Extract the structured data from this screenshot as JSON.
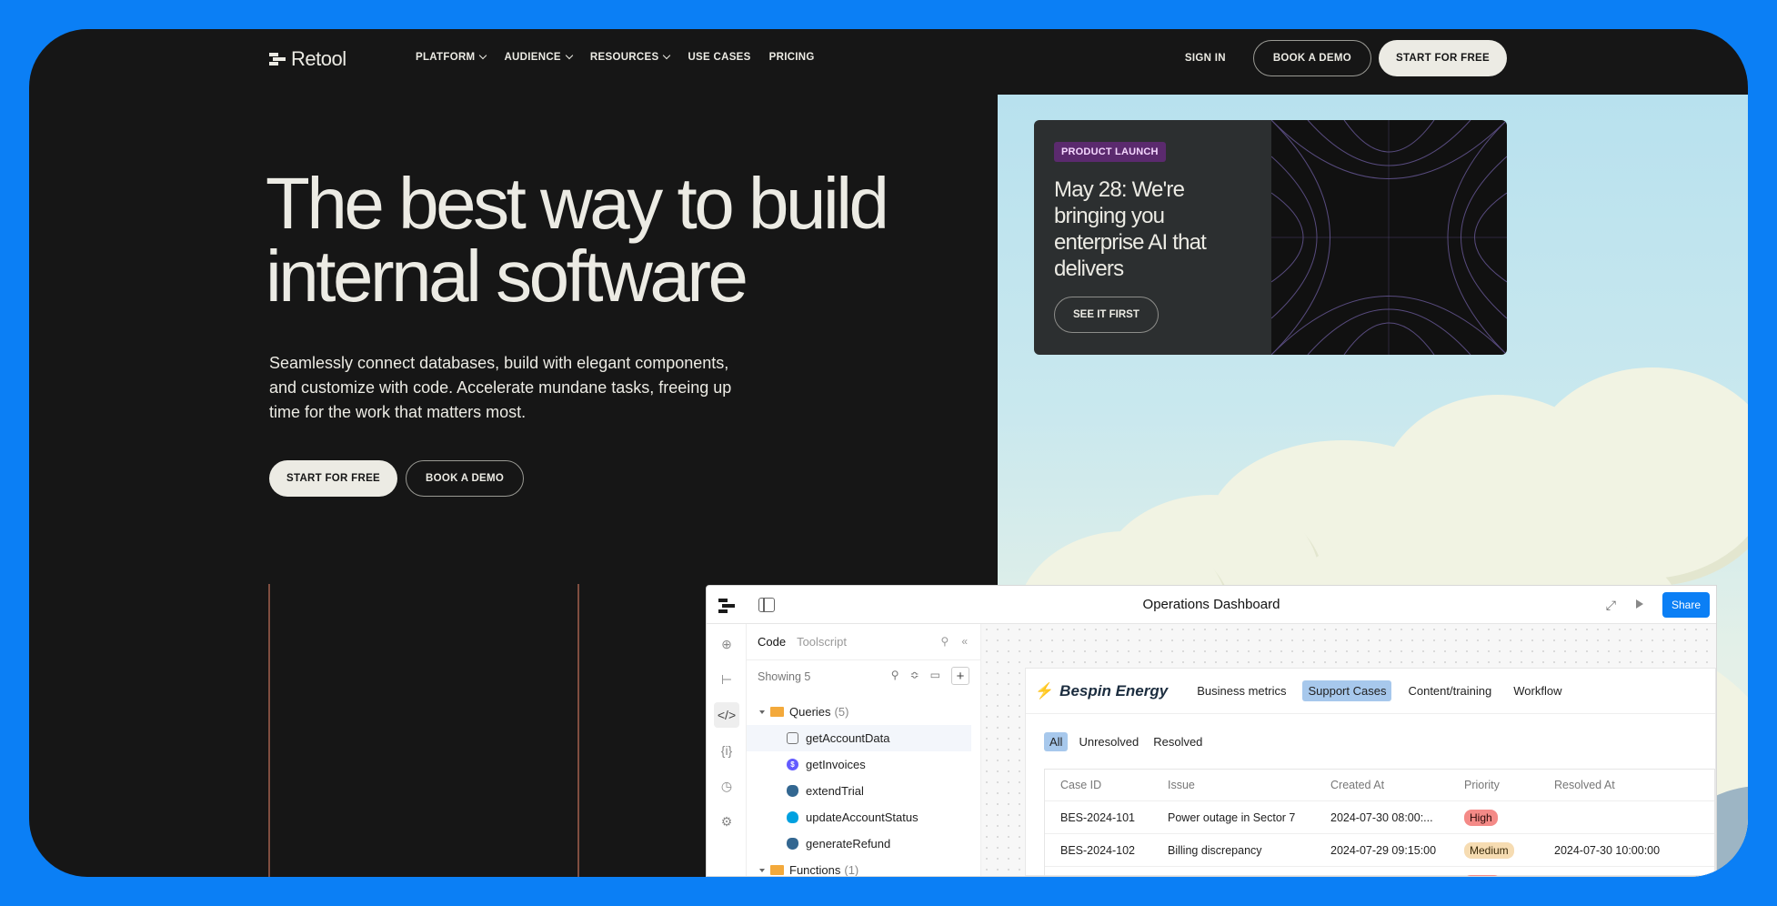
{
  "nav": {
    "logo": "Retool",
    "links": [
      {
        "label": "PLATFORM",
        "dropdown": true
      },
      {
        "label": "AUDIENCE",
        "dropdown": true
      },
      {
        "label": "RESOURCES",
        "dropdown": true
      },
      {
        "label": "USE CASES",
        "dropdown": false
      },
      {
        "label": "PRICING",
        "dropdown": false
      }
    ],
    "sign_in": "SIGN IN",
    "book_demo": "BOOK A DEMO",
    "start_free": "START FOR FREE"
  },
  "hero": {
    "title_line1": "The best way to build",
    "title_line2": "internal software",
    "subtitle": "Seamlessly connect databases, build with elegant components, and customize with code. Accelerate mundane tasks, freeing up time for the work that matters most.",
    "cta_primary": "START FOR FREE",
    "cta_secondary": "BOOK A DEMO"
  },
  "launch": {
    "badge": "PRODUCT LAUNCH",
    "title": "May 28: We're bringing you enterprise AI that delivers",
    "cta": "SEE IT FIRST"
  },
  "app": {
    "title": "Operations Dashboard",
    "share": "Share",
    "code_panel": {
      "tabs": [
        "Code",
        "Toolscript"
      ],
      "showing": "Showing 5",
      "queries_folder": "Queries",
      "queries_count": "(5)",
      "queries": [
        {
          "name": "getAccountData",
          "icon": "database-icon"
        },
        {
          "name": "getInvoices",
          "icon": "stripe-icon"
        },
        {
          "name": "extendTrial",
          "icon": "postgres-icon"
        },
        {
          "name": "updateAccountStatus",
          "icon": "salesforce-icon"
        },
        {
          "name": "generateRefund",
          "icon": "postgres-icon"
        }
      ],
      "functions_folder": "Functions",
      "functions_count": "(1)"
    },
    "dashboard": {
      "brand": "Bespin Energy",
      "nav": [
        "Business metrics",
        "Support Cases",
        "Content/training",
        "Workflow"
      ],
      "active_nav": "Support Cases",
      "filters": [
        "All",
        "Unresolved",
        "Resolved"
      ],
      "columns": [
        "Case ID",
        "Issue",
        "Created At",
        "Priority",
        "Resolved At"
      ],
      "rows": [
        {
          "id": "BES-2024-101",
          "issue": "Power outage in Sector 7",
          "created": "2024-07-30 08:00:...",
          "priority": "High",
          "resolved": ""
        },
        {
          "id": "BES-2024-102",
          "issue": "Billing discrepancy",
          "created": "2024-07-29 09:15:00",
          "priority": "Medium",
          "resolved": "2024-07-30 10:00:00"
        }
      ]
    }
  },
  "colors": {
    "background": "#0b7ff5",
    "dark": "#161616",
    "cream": "#ecebe4",
    "accent_blue": "#0b7ff5",
    "grid_line": "#e8876b"
  }
}
